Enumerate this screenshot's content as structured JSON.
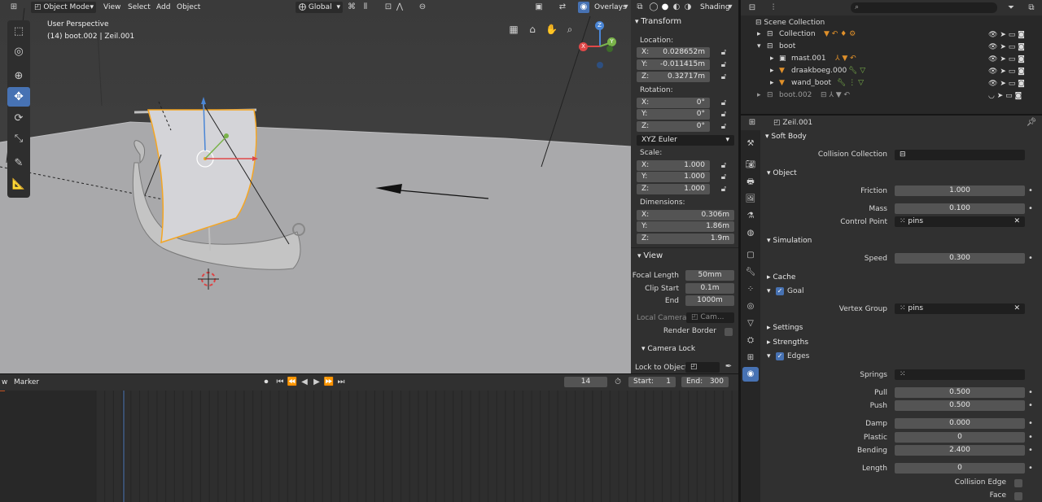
{
  "viewport_header": {
    "mode_label": "Object Mode",
    "menu": [
      "View",
      "Select",
      "Add",
      "Object"
    ],
    "transform_orientation": "Global",
    "overlays_label": "Overlays",
    "shading_label": "Shading"
  },
  "viewport": {
    "perspective_label": "User Perspective",
    "object_label": "(14) boot.002 | Zeil.001",
    "gizmo_x": "X",
    "gizmo_y": "Y",
    "gizmo_z": "Z"
  },
  "npanel": {
    "transform_title": "Transform",
    "location_label": "Location:",
    "location": [
      {
        "axis": "X:",
        "value": "0.028652m"
      },
      {
        "axis": "Y:",
        "value": "-0.011415m"
      },
      {
        "axis": "Z:",
        "value": "0.32717m"
      }
    ],
    "rotation_label": "Rotation:",
    "rotation": [
      {
        "axis": "X:",
        "value": "0°"
      },
      {
        "axis": "Y:",
        "value": "0°"
      },
      {
        "axis": "Z:",
        "value": "0°"
      }
    ],
    "rotation_mode": "XYZ Euler",
    "scale_label": "Scale:",
    "scale": [
      {
        "axis": "X:",
        "value": "1.000"
      },
      {
        "axis": "Y:",
        "value": "1.000"
      },
      {
        "axis": "Z:",
        "value": "1.000"
      }
    ],
    "dimensions_label": "Dimensions:",
    "dimensions": [
      {
        "axis": "X:",
        "value": "0.306m"
      },
      {
        "axis": "Y:",
        "value": "1.86m"
      },
      {
        "axis": "Z:",
        "value": "1.9m"
      }
    ],
    "view_title": "View",
    "focal_length_label": "Focal Length",
    "focal_length": "50mm",
    "clip_start_label": "Clip Start",
    "clip_start": "0.1m",
    "end_label": "End",
    "end": "1000m",
    "local_camera_label": "Local Camera",
    "local_camera_value": "Cam...",
    "render_border_label": "Render Border",
    "camera_lock_title": "Camera Lock",
    "lock_to_object_label": "Lock to Object"
  },
  "timeline": {
    "view_label": "w",
    "marker_label": "Marker",
    "current_frame": "14",
    "start_label": "Start:",
    "start_value": "1",
    "end_label": "End:",
    "end_value": "300"
  },
  "outliner": {
    "scene_collection": "Scene Collection",
    "items": [
      {
        "label": "Collection",
        "indent": 1
      },
      {
        "label": "boot",
        "indent": 1
      },
      {
        "label": "mast.001",
        "indent": 2
      },
      {
        "label": "draakboeg.000",
        "indent": 2
      },
      {
        "label": "wand_boot",
        "indent": 2
      },
      {
        "label": "boot.002",
        "indent": 1
      }
    ]
  },
  "properties": {
    "object_name": "Zeil.001",
    "soft_body_title": "Soft Body",
    "collision_collection_label": "Collision Collection",
    "object_title": "Object",
    "friction_label": "Friction",
    "friction": "1.000",
    "mass_label": "Mass",
    "mass": "0.100",
    "control_point_label": "Control Point",
    "control_point": "pins",
    "simulation_title": "Simulation",
    "speed_label": "Speed",
    "speed": "0.300",
    "cache_title": "Cache",
    "goal_title": "Goal",
    "vertex_group_label": "Vertex Group",
    "vertex_group": "pins",
    "settings_title": "Settings",
    "strengths_title": "Strengths",
    "edges_title": "Edges",
    "springs_label": "Springs",
    "pull_label": "Pull",
    "pull": "0.500",
    "push_label": "Push",
    "push": "0.500",
    "damp_label": "Damp",
    "damp": "0.000",
    "plastic_label": "Plastic",
    "plastic": "0",
    "bending_label": "Bending",
    "bending": "2.400",
    "length_label": "Length",
    "length": "0",
    "collision_edge_label": "Collision Edge",
    "face_label": "Face"
  },
  "colors": {
    "accent": "#4772b3",
    "panel": "#303030",
    "field": "#545454",
    "selection_orange": "#f5a623"
  }
}
